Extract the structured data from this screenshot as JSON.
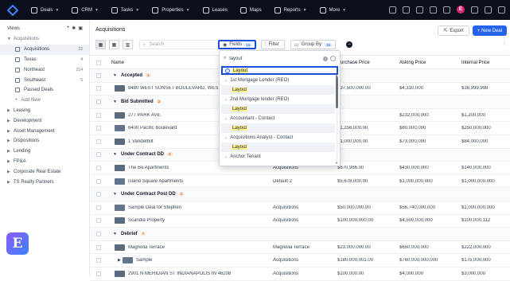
{
  "nav": {
    "items": [
      "Deals",
      "CRM",
      "Tasks",
      "Properties",
      "Leases",
      "Maps",
      "Reports",
      "More"
    ],
    "avatar_initial": "E"
  },
  "sidebar": {
    "header": "Views",
    "items": [
      {
        "label": "Acquisitions",
        "type": "group-open"
      },
      {
        "label": "Acquisitions",
        "count": "22",
        "type": "child",
        "active": true
      },
      {
        "label": "Texas",
        "count": "4",
        "type": "child"
      },
      {
        "label": "Northeast",
        "count": "214",
        "type": "child"
      },
      {
        "label": "Southeast",
        "count": "5",
        "type": "child"
      },
      {
        "label": "Passed Deals",
        "count": "",
        "type": "child"
      },
      {
        "label": "Add New",
        "count": "",
        "type": "add"
      },
      {
        "label": "Leasing",
        "type": "group"
      },
      {
        "label": "Development",
        "type": "group"
      },
      {
        "label": "Asset Management",
        "type": "group"
      },
      {
        "label": "Dispositions",
        "type": "group"
      },
      {
        "label": "Lending",
        "type": "group"
      },
      {
        "label": "FP&A",
        "type": "group"
      },
      {
        "label": "Corporate Real Estate",
        "type": "group"
      },
      {
        "label": "TS Realty Partners",
        "type": "group"
      }
    ],
    "brand_letter": "E"
  },
  "main": {
    "title": "Acquisitions",
    "export_label": "Export",
    "new_label": "+ New Deal"
  },
  "toolbar": {
    "search_placeholder": "Search",
    "fields_label": "Fields",
    "fields_count": "13",
    "filter_label": "Filter",
    "groupby_label": "Group By",
    "groupby_count": "16"
  },
  "table": {
    "headers": [
      "Name",
      "Purchase Price",
      "Asking Price",
      "Internal Price"
    ],
    "rows": [
      {
        "kind": "group",
        "name": "Accepted",
        "badge": "1"
      },
      {
        "kind": "deal",
        "name": "8480 WEST SUNSET BOULEVARD, WEST HOLLYWOOD...",
        "team": "",
        "purchase": "$37,500,000.00",
        "asking": "$4,310,000",
        "internal": "$36,999,998"
      },
      {
        "kind": "group",
        "name": "Bid Submitted",
        "badge": "2"
      },
      {
        "kind": "deal",
        "name": "277 PARK AVE.",
        "team": "",
        "purchase": "-",
        "asking": "$232,000,000",
        "internal": "$1,200,000"
      },
      {
        "kind": "deal",
        "name": "6400 Pacific Boulevard",
        "team": "",
        "purchase": "$1,256,000.00",
        "asking": "$80,000,000",
        "internal": "$250,000,000"
      },
      {
        "kind": "deal",
        "name": "1 Vanderbilt",
        "team": "",
        "purchase": "$1,000,000.00",
        "asking": "$73,000,000",
        "internal": "$84,000,000"
      },
      {
        "kind": "group",
        "name": "Under Contract DD",
        "badge": "2"
      },
      {
        "kind": "deal",
        "name": "The Bo Apartments",
        "team": "Acquisitions",
        "purchase": "$670,986.00",
        "asking": "$430,000,000",
        "internal": "$140,000,000"
      },
      {
        "kind": "deal",
        "name": "Island Square Apartments",
        "team": "Default 2",
        "purchase": "$5,678,000.00",
        "asking": "$1,000,000,000",
        "internal": "$1,000,000,000"
      },
      {
        "kind": "group",
        "name": "Under Contract Post DD",
        "badge": "2"
      },
      {
        "kind": "deal",
        "name": "Sample Deal for Stephen",
        "team": "Acquisitions",
        "purchase": "$50,000,000.00",
        "asking": "$56,740,000,000",
        "internal": "$1,000,000,000"
      },
      {
        "kind": "deal",
        "name": "Scandia Property",
        "team": "Acquisitions",
        "purchase": "$100,000,000.00",
        "asking": "$4,500,000,000",
        "internal": "$100,000,112"
      },
      {
        "kind": "group",
        "name": "Debrief",
        "badge": "7"
      },
      {
        "kind": "deal",
        "name": "Magnolia Terrace",
        "team": "Magnolia Terrace",
        "purchase": "$23,000,000.00",
        "asking": "$650,000,000",
        "internal": "$222,000,000"
      },
      {
        "kind": "deal",
        "name": "Sample",
        "team": "Acquisitions",
        "purchase": "$180,000,001.00",
        "asking": "$760,000,000,000",
        "internal": "$175,000,000"
      },
      {
        "kind": "deal",
        "name": "2901 N MERIDIAN ST INDIANAPOLIS IN 46208",
        "team": "Acquisitions",
        "purchase": "$100,000.00",
        "asking": "$4,000,000",
        "internal": "$3,000,000"
      }
    ]
  },
  "field_picker": {
    "query": "layout",
    "top_option": "Layout",
    "groups": [
      {
        "label": "1st Mortgage Lender (REO)",
        "child": "Layout"
      },
      {
        "label": "2nd Mortgage lender (REO)",
        "child": "Layout"
      },
      {
        "label": "Accountant - Contact",
        "child": "Layout"
      },
      {
        "label": "Acquisitions Analyst - Contact",
        "child": "Layout"
      },
      {
        "label": "Anchor Tenant",
        "child": ""
      }
    ]
  },
  "colors": {
    "accent": "#2563eb",
    "topbar": "#0b0f1e",
    "highlight": "#fef08a",
    "badge": "#ea580c"
  }
}
